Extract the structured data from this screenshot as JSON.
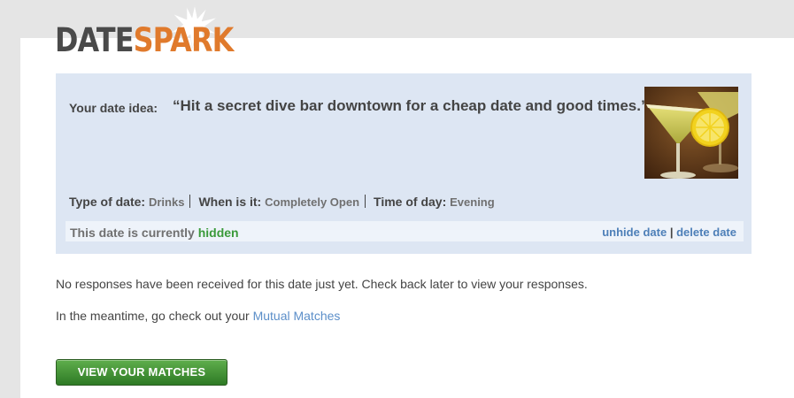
{
  "logo": {
    "part1": "DATE",
    "part2": "SPARK"
  },
  "idea": {
    "label": "Your date idea:",
    "text": "“Hit a secret dive bar downtown for a cheap date and good times.”"
  },
  "details": {
    "type_label": "Type of date:",
    "type_value": "Drinks",
    "when_label": "When is it:",
    "when_value": "Completely Open",
    "time_label": "Time of day:",
    "time_value": "Evening"
  },
  "status": {
    "prefix": "This date is currently",
    "state": "hidden",
    "unhide_link": "unhide date",
    "separator": "|",
    "delete_link": "delete date"
  },
  "messages": {
    "no_responses": "No responses have been received for this date just yet. Check back later to view your responses.",
    "meantime": "In the meantime, go check out your",
    "mutual_matches_link": "Mutual Matches"
  },
  "cta": {
    "label": "VIEW YOUR MATCHES"
  },
  "colors": {
    "brand_orange": "#e07a2c",
    "panel_bg": "#dde6f3",
    "link_blue": "#4d7fb8",
    "status_green": "#3a9a3a",
    "button_green": "#3f8f32"
  }
}
